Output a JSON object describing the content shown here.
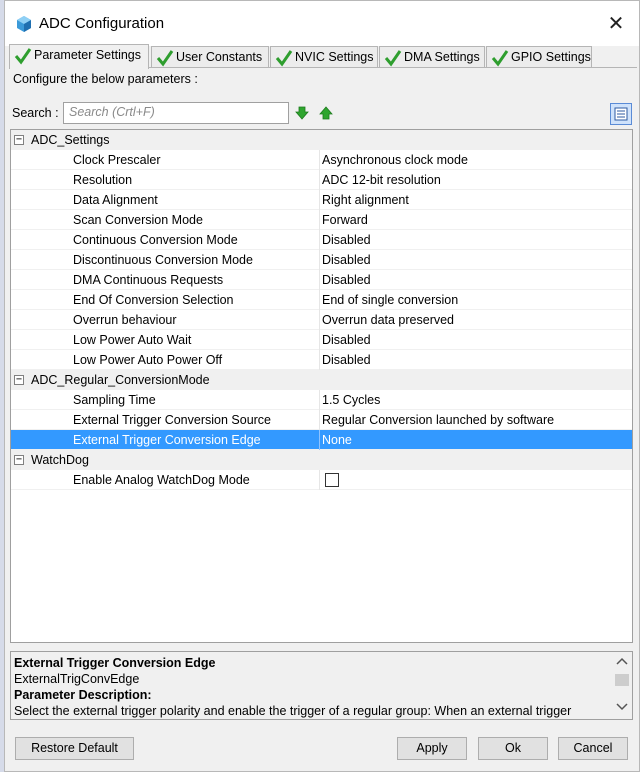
{
  "window": {
    "title": "ADC Configuration",
    "close_glyph": "✕"
  },
  "tabs": [
    {
      "label": "Parameter Settings",
      "icon": "check-icon",
      "active": true
    },
    {
      "label": "User Constants",
      "icon": "check-icon",
      "active": false
    },
    {
      "label": "NVIC Settings",
      "icon": "check-icon",
      "active": false
    },
    {
      "label": "DMA Settings",
      "icon": "check-icon",
      "active": false
    },
    {
      "label": "GPIO Settings",
      "icon": "check-icon",
      "active": false
    }
  ],
  "header": {
    "configure_text": "Configure the below parameters :"
  },
  "search": {
    "label": "Search :",
    "placeholder": "Search (Crtl+F)"
  },
  "groups": [
    {
      "name": "ADC_Settings",
      "toggle": "−",
      "params": [
        {
          "name": "Clock Prescaler",
          "value": "Asynchronous clock mode"
        },
        {
          "name": "Resolution",
          "value": "ADC 12-bit resolution"
        },
        {
          "name": "Data Alignment",
          "value": "Right alignment"
        },
        {
          "name": "Scan Conversion Mode",
          "value": "Forward"
        },
        {
          "name": "Continuous Conversion Mode",
          "value": "Disabled"
        },
        {
          "name": "Discontinuous Conversion Mode",
          "value": "Disabled"
        },
        {
          "name": "DMA Continuous Requests",
          "value": "Disabled"
        },
        {
          "name": "End Of Conversion Selection",
          "value": "End of single conversion"
        },
        {
          "name": "Overrun behaviour",
          "value": "Overrun data preserved"
        },
        {
          "name": "Low Power Auto Wait",
          "value": "Disabled"
        },
        {
          "name": "Low Power Auto Power Off",
          "value": "Disabled"
        }
      ]
    },
    {
      "name": "ADC_Regular_ConversionMode",
      "toggle": "−",
      "params": [
        {
          "name": "Sampling Time",
          "value": "1.5 Cycles"
        },
        {
          "name": "External Trigger Conversion Source",
          "value": "Regular Conversion launched by software"
        },
        {
          "name": "External Trigger Conversion Edge",
          "value": "None",
          "selected": true
        }
      ]
    },
    {
      "name": "WatchDog",
      "toggle": "−",
      "params": [
        {
          "name": "Enable Analog WatchDog Mode",
          "value": "",
          "checkbox": true,
          "checked": false
        }
      ]
    }
  ],
  "description": {
    "title": "External Trigger Conversion Edge",
    "identifier": "ExternalTrigConvEdge",
    "heading": "Parameter Description:",
    "text": "Select the external trigger polarity and enable the trigger of a regular group: When an external trigger"
  },
  "buttons": {
    "restore": "Restore Default",
    "apply": "Apply",
    "ok": "Ok",
    "cancel": "Cancel"
  },
  "colors": {
    "selected_row": "#3399ff",
    "check_green": "#2e9e2e",
    "arrow_green": "#2fa52f"
  }
}
